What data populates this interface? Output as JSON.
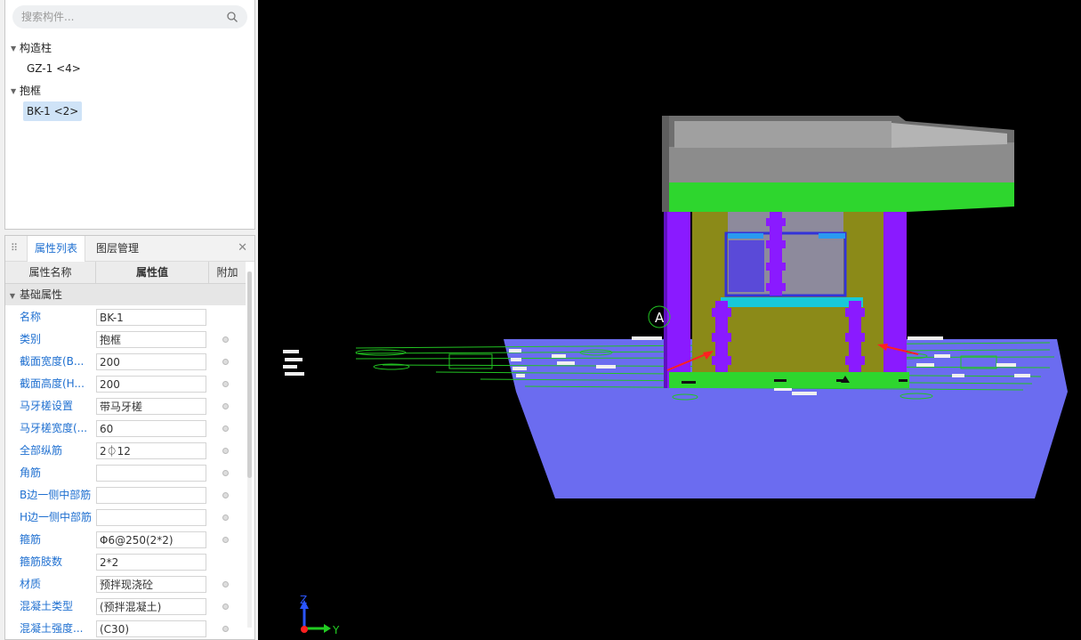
{
  "search": {
    "placeholder": "搜索构件..."
  },
  "tree": {
    "groups": [
      {
        "label": "构造柱",
        "items": [
          {
            "label": "GZ-1 <4>"
          }
        ]
      },
      {
        "label": "抱框",
        "items": [
          {
            "label": "BK-1 <2>",
            "selected": true
          }
        ]
      }
    ]
  },
  "tabs": [
    {
      "label": "属性列表",
      "active": true
    },
    {
      "label": "图层管理",
      "active": false
    }
  ],
  "table": {
    "headers": [
      "属性名称",
      "属性值",
      "附加"
    ],
    "section": "基础属性",
    "rows": [
      {
        "name": "名称",
        "value": "BK-1",
        "attach": false
      },
      {
        "name": "类别",
        "value": "抱框",
        "attach": true
      },
      {
        "name": "截面宽度(B...",
        "value": "200",
        "attach": true
      },
      {
        "name": "截面高度(H...",
        "value": "200",
        "attach": true
      },
      {
        "name": "马牙槎设置",
        "value": "带马牙槎",
        "attach": true
      },
      {
        "name": "马牙槎宽度(...",
        "value": "60",
        "attach": true
      },
      {
        "name": "全部纵筋",
        "value": "2⏀12",
        "attach": true
      },
      {
        "name": "角筋",
        "value": "",
        "attach": true
      },
      {
        "name": "B边一侧中部筋",
        "value": "",
        "attach": true
      },
      {
        "name": "H边一侧中部筋",
        "value": "",
        "attach": true
      },
      {
        "name": "箍筋",
        "value": "Φ6@250(2*2)",
        "attach": true
      },
      {
        "name": "箍筋肢数",
        "value": "2*2",
        "attach": false
      },
      {
        "name": "材质",
        "value": "预拌现浇砼",
        "attach": true
      },
      {
        "name": "混凝土类型",
        "value": "(预拌混凝土)",
        "attach": true
      },
      {
        "name": "混凝土强度...",
        "value": "(C30)",
        "attach": true
      }
    ]
  },
  "viewport": {
    "axis": {
      "z": "Z",
      "y": "Y"
    },
    "marker_label": "A",
    "colors": {
      "slab": "#6b6cf0",
      "beam_green": "#2ed62e",
      "parapet_gray": "#8c8c8c",
      "wall_olive": "#8b8a18",
      "column_purple": "#8a1aff",
      "glass_blue": "#4a4ad8",
      "arrow_red": "#ff2020"
    }
  }
}
